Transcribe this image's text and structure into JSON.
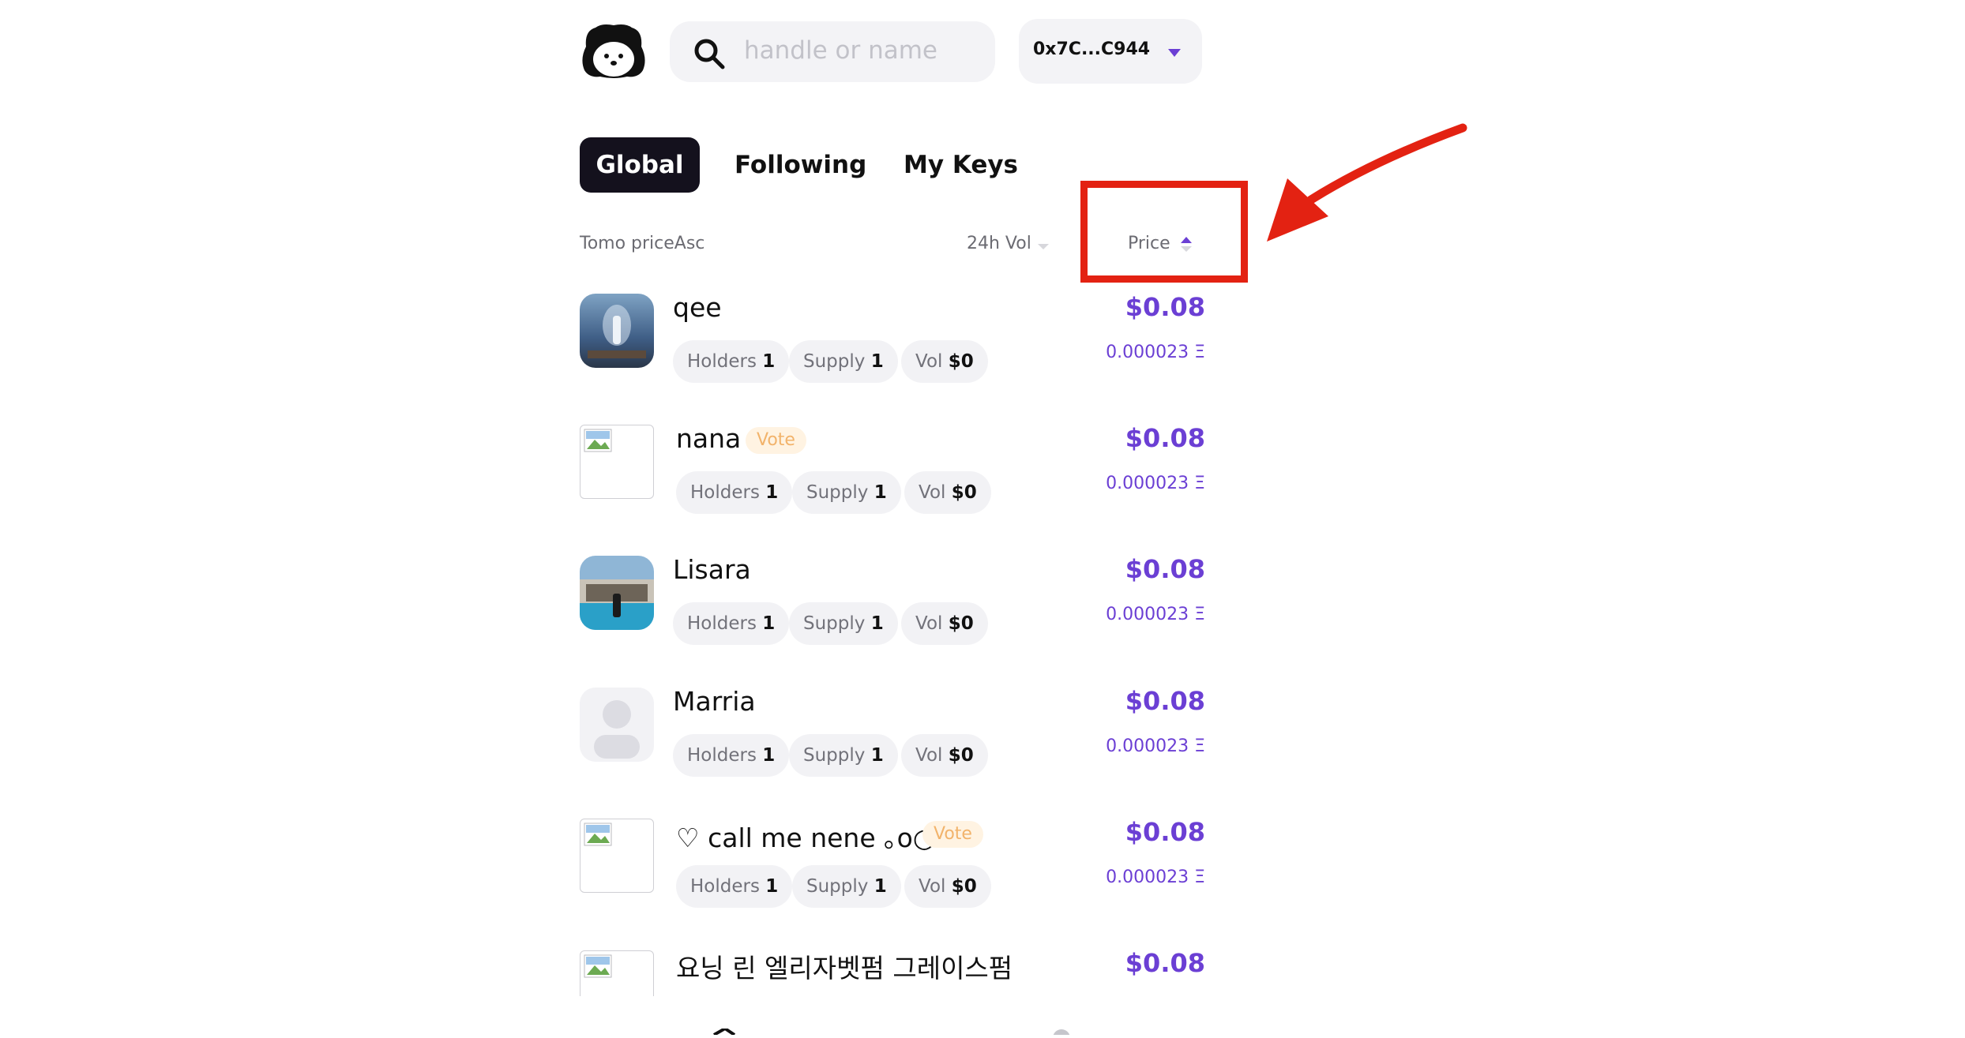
{
  "header": {
    "search": {
      "placeholder": "handle or name"
    },
    "wallet": {
      "address": "0x7C...C944"
    }
  },
  "tabs": [
    {
      "label": "Global",
      "active": true
    },
    {
      "label": "Following",
      "active": false
    },
    {
      "label": "My Keys",
      "active": false
    }
  ],
  "columns": {
    "sort_label": "Tomo priceAsc",
    "vol_label": "24h Vol",
    "price_label": "Price",
    "price_sort": "ascending"
  },
  "rows": [
    {
      "name": "qee",
      "vote": "",
      "holders_label": "Holders",
      "holders": "1",
      "supply_label": "Supply",
      "supply": "1",
      "vol_label": "Vol",
      "vol": "$0",
      "price_usd": "$0.08",
      "price_eth": "0.000023 Ξ",
      "avatar": "photo-fantasy"
    },
    {
      "name": "nana",
      "vote": "Vote",
      "holders_label": "Holders",
      "holders": "1",
      "supply_label": "Supply",
      "supply": "1",
      "vol_label": "Vol",
      "vol": "$0",
      "price_usd": "$0.08",
      "price_eth": "0.000023 Ξ",
      "avatar": "broken-image"
    },
    {
      "name": "Lisara",
      "vote": "",
      "holders_label": "Holders",
      "holders": "1",
      "supply_label": "Supply",
      "supply": "1",
      "vol_label": "Vol",
      "vol": "$0",
      "price_usd": "$0.08",
      "price_eth": "0.000023 Ξ",
      "avatar": "photo-pool"
    },
    {
      "name": "Marria",
      "vote": "",
      "holders_label": "Holders",
      "holders": "1",
      "supply_label": "Supply",
      "supply": "1",
      "vol_label": "Vol",
      "vol": "$0",
      "price_usd": "$0.08",
      "price_eth": "0.000023 Ξ",
      "avatar": "default-person"
    },
    {
      "name": "♡ call me nene ｡o○",
      "vote": "Vote",
      "holders_label": "Holders",
      "holders": "1",
      "supply_label": "Supply",
      "supply": "1",
      "vol_label": "Vol",
      "vol": "$0",
      "price_usd": "$0.08",
      "price_eth": "0.000023 Ξ",
      "avatar": "broken-image"
    },
    {
      "name": "요닝 린 엘리자벳펌 그레이스펌",
      "vote": "",
      "price_usd": "$0.08",
      "avatar": "broken-image"
    }
  ],
  "colors": {
    "accent": "#6b3fd4",
    "annotation": "#e32212",
    "tab_active_bg": "#14111d"
  }
}
